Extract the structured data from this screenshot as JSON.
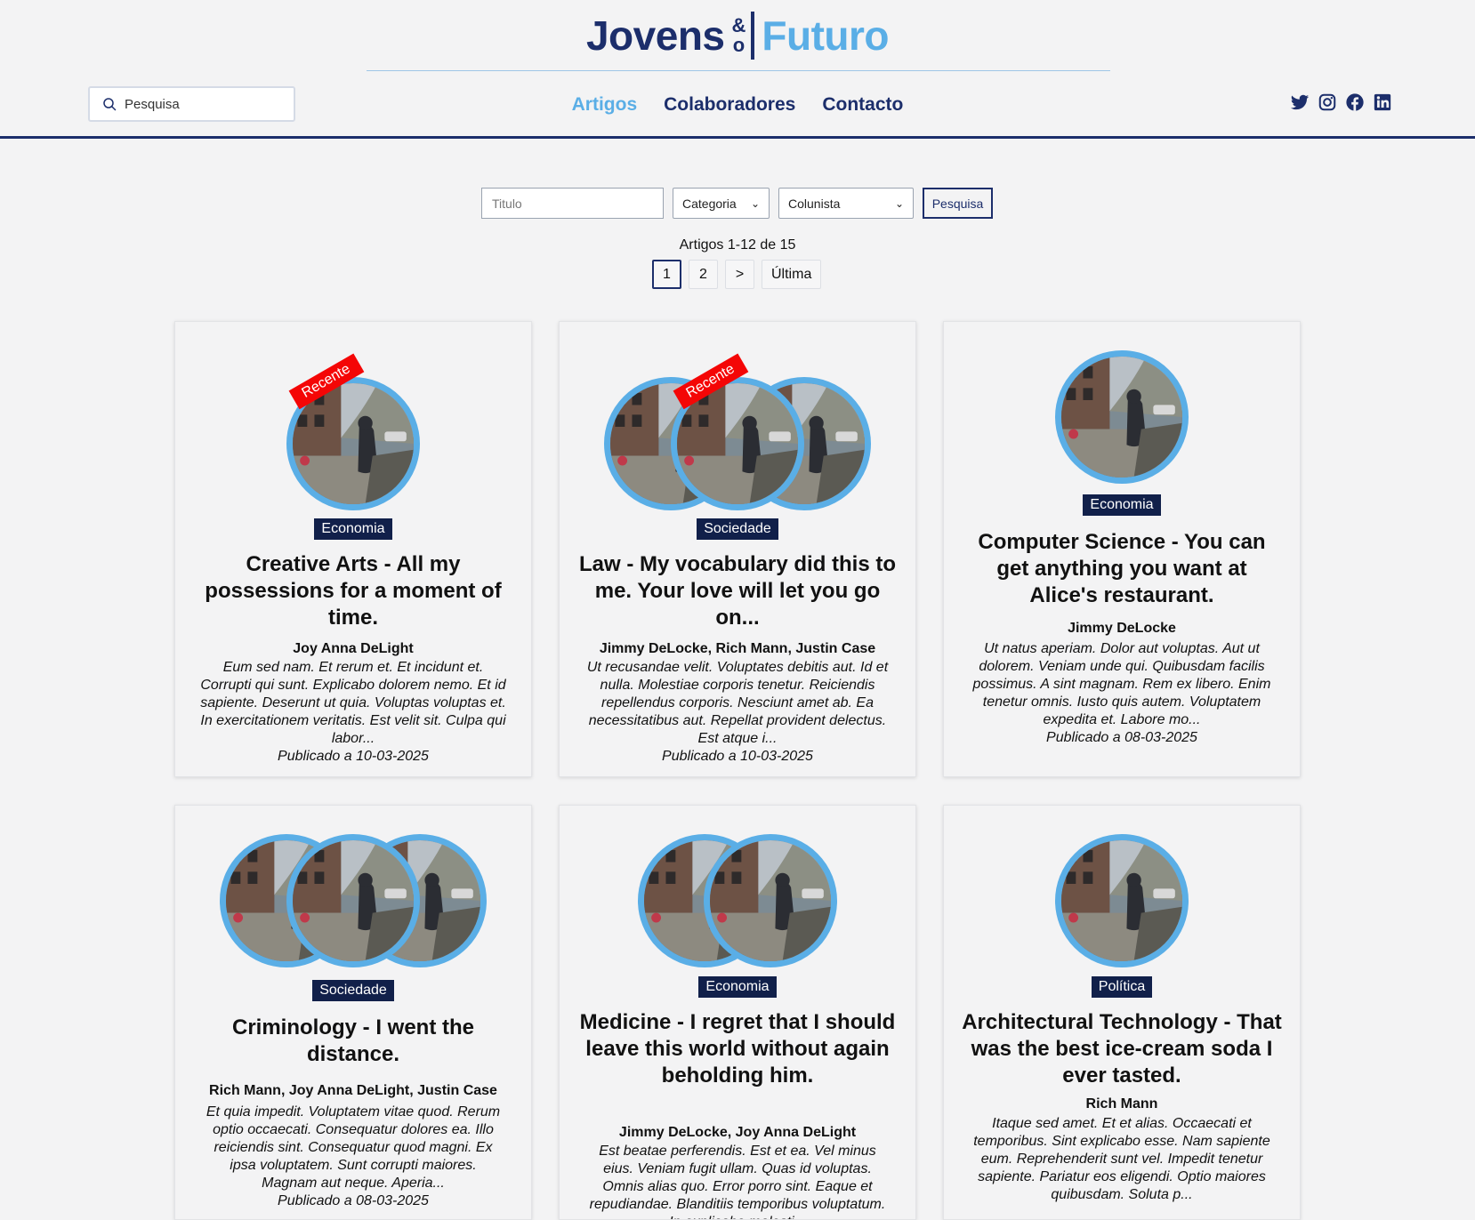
{
  "logo": {
    "part1": "Jovens",
    "amp_top": "&",
    "amp_bottom": "o",
    "part2": "Futuro"
  },
  "search": {
    "placeholder": "Pesquisa"
  },
  "nav": [
    {
      "label": "Artigos",
      "active": true
    },
    {
      "label": "Colaboradores",
      "active": false
    },
    {
      "label": "Contacto",
      "active": false
    }
  ],
  "social": [
    "twitter-icon",
    "instagram-icon",
    "facebook-icon",
    "linkedin-icon"
  ],
  "filters": {
    "title_placeholder": "Titulo",
    "category_label": "Categoria",
    "columnist_label": "Colunista",
    "submit_label": "Pesquisa"
  },
  "results": {
    "count_text": "Artigos 1-12 de 15"
  },
  "pagination": {
    "pages": [
      "1",
      "2"
    ],
    "next": ">",
    "last": "Última",
    "current": "1"
  },
  "colors": {
    "navy": "#1c2e6b",
    "accent": "#5aaee6",
    "badge_red": "#f40606",
    "category_bg": "#11204a"
  },
  "badge_text": "Recente",
  "articles": [
    {
      "category": "Economia",
      "title": "Creative Arts - All my possessions for a moment of time.",
      "authors": "Joy Anna DeLight",
      "excerpt": "Eum sed nam. Et rerum et. Et incidunt et. Corrupti qui sunt. Explicabo dolorem nemo. Et id sapiente. Deserunt ut quia. Voluptas voluptas et. In exercitationem veritatis. Est velit sit. Culpa qui labor...",
      "date": "Publicado a 10-03-2025",
      "recent": true,
      "avatar_count": 1
    },
    {
      "category": "Sociedade",
      "title": "Law - My vocabulary did this to me. Your love will let you go on...",
      "authors": "Jimmy DeLocke, Rich Mann, Justin Case",
      "excerpt": "Ut recusandae velit. Voluptates debitis aut. Id et nulla. Molestiae corporis tenetur. Reiciendis repellendus corporis. Nesciunt amet ab. Ea necessitatibus aut. Repellat provident delectus. Est atque i...",
      "date": "Publicado a 10-03-2025",
      "recent": true,
      "avatar_count": 3
    },
    {
      "category": "Economia",
      "title": "Computer Science - You can get anything you want at Alice's restaurant.",
      "authors": "Jimmy DeLocke",
      "excerpt": "Ut natus aperiam. Dolor aut voluptas. Aut ut dolorem. Veniam unde qui. Quibusdam facilis possimus. A sint magnam. Rem ex libero. Enim tenetur omnis. Iusto quis autem. Voluptatem expedita et. Labore mo...",
      "date": "Publicado a 08-03-2025",
      "recent": false,
      "avatar_count": 1
    },
    {
      "category": "Sociedade",
      "title": "Criminology - I went the distance.",
      "authors": "Rich Mann, Joy Anna DeLight, Justin Case",
      "excerpt": "Et quia impedit. Voluptatem vitae quod. Rerum optio occaecati. Consequatur dolores ea. Illo reiciendis sint. Consequatur quod magni. Ex ipsa voluptatem. Sunt corrupti maiores. Magnam aut neque. Aperia...",
      "date": "Publicado a 08-03-2025",
      "recent": false,
      "avatar_count": 3
    },
    {
      "category": "Economia",
      "title": "Medicine - I regret that I should leave this world without again beholding him.",
      "authors": "Jimmy DeLocke, Joy Anna DeLight",
      "excerpt": "Est beatae perferendis. Est et ea. Vel minus eius. Veniam fugit ullam. Quas id voluptas. Omnis alias quo. Error porro sint. Eaque et repudiandae. Blanditiis temporibus voluptatum. In explicabo molesti...",
      "date": "",
      "recent": false,
      "avatar_count": 2
    },
    {
      "category": "Política",
      "title": "Architectural Technology - That was the best ice-cream soda I ever tasted.",
      "authors": "Rich Mann",
      "excerpt": "Itaque sed amet. Et et alias. Occaecati et temporibus. Sint explicabo esse. Nam sapiente eum. Reprehenderit sunt vel. Impedit tenetur sapiente. Pariatur eos eligendi. Optio maiores quibusdam. Soluta p...",
      "date": "",
      "recent": false,
      "avatar_count": 1
    }
  ]
}
